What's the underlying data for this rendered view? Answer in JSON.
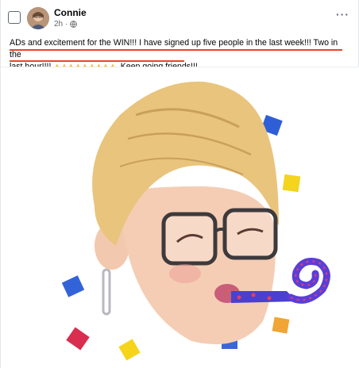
{
  "post": {
    "author": "Connie",
    "time": "2h",
    "more_label": "···",
    "text_line1": "ADs and excitement for the WIN!!! I have signed up five people in the last week!!! Two in the",
    "text_line2_start": "last hour!!!! ",
    "text_emojis": "👍👍👍👍👍👍👍👍👍",
    "text_line2_end": ". Keep going friends!!!"
  },
  "colors": {
    "highlight": "#e8462a",
    "meta_gray": "#65676b"
  },
  "icons": {
    "checkbox": "checkbox-icon",
    "globe": "globe-icon",
    "more": "more-options-icon"
  }
}
